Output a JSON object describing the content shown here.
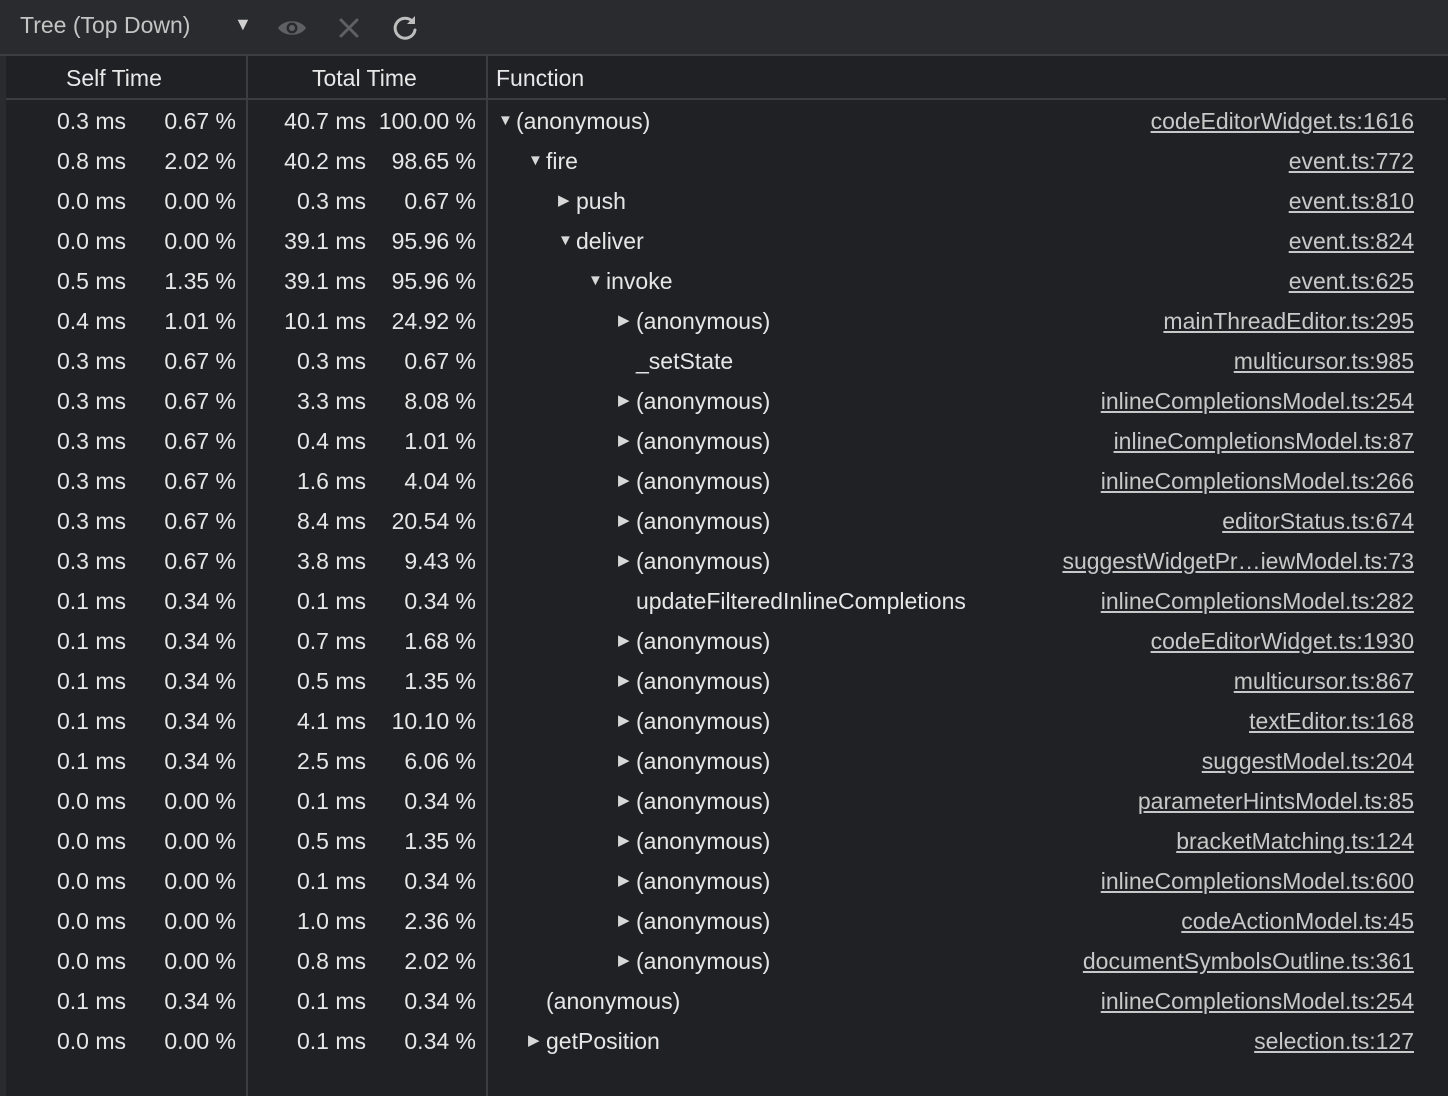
{
  "toolbar": {
    "view_select": "Tree (Top Down)",
    "icons": [
      "eye-icon",
      "close-icon",
      "reload-icon"
    ]
  },
  "headers": {
    "self_time": "Self Time",
    "total_time": "Total Time",
    "function": "Function"
  },
  "rows": [
    {
      "self": "0.3 ms",
      "self_pct": "0.67 %",
      "total": "40.7 ms",
      "total_pct": "100.00 %",
      "depth": 0,
      "state": "expanded",
      "fn": "(anonymous)",
      "url": "codeEditorWidget.ts:1616"
    },
    {
      "self": "0.8 ms",
      "self_pct": "2.02 %",
      "total": "40.2 ms",
      "total_pct": "98.65 %",
      "depth": 1,
      "state": "expanded",
      "fn": "fire",
      "url": "event.ts:772"
    },
    {
      "self": "0.0 ms",
      "self_pct": "0.00 %",
      "total": "0.3 ms",
      "total_pct": "0.67 %",
      "depth": 2,
      "state": "collapsed",
      "fn": "push",
      "url": "event.ts:810"
    },
    {
      "self": "0.0 ms",
      "self_pct": "0.00 %",
      "total": "39.1 ms",
      "total_pct": "95.96 %",
      "depth": 2,
      "state": "expanded",
      "fn": "deliver",
      "url": "event.ts:824"
    },
    {
      "self": "0.5 ms",
      "self_pct": "1.35 %",
      "total": "39.1 ms",
      "total_pct": "95.96 %",
      "depth": 3,
      "state": "expanded",
      "fn": "invoke",
      "url": "event.ts:625"
    },
    {
      "self": "0.4 ms",
      "self_pct": "1.01 %",
      "total": "10.1 ms",
      "total_pct": "24.92 %",
      "depth": 4,
      "state": "collapsed",
      "fn": "(anonymous)",
      "url": "mainThreadEditor.ts:295"
    },
    {
      "self": "0.3 ms",
      "self_pct": "0.67 %",
      "total": "0.3 ms",
      "total_pct": "0.67 %",
      "depth": 4,
      "state": "leaf",
      "fn": "_setState",
      "url": "multicursor.ts:985"
    },
    {
      "self": "0.3 ms",
      "self_pct": "0.67 %",
      "total": "3.3 ms",
      "total_pct": "8.08 %",
      "depth": 4,
      "state": "collapsed",
      "fn": "(anonymous)",
      "url": "inlineCompletionsModel.ts:254"
    },
    {
      "self": "0.3 ms",
      "self_pct": "0.67 %",
      "total": "0.4 ms",
      "total_pct": "1.01 %",
      "depth": 4,
      "state": "collapsed",
      "fn": "(anonymous)",
      "url": "inlineCompletionsModel.ts:87"
    },
    {
      "self": "0.3 ms",
      "self_pct": "0.67 %",
      "total": "1.6 ms",
      "total_pct": "4.04 %",
      "depth": 4,
      "state": "collapsed",
      "fn": "(anonymous)",
      "url": "inlineCompletionsModel.ts:266"
    },
    {
      "self": "0.3 ms",
      "self_pct": "0.67 %",
      "total": "8.4 ms",
      "total_pct": "20.54 %",
      "depth": 4,
      "state": "collapsed",
      "fn": "(anonymous)",
      "url": "editorStatus.ts:674"
    },
    {
      "self": "0.3 ms",
      "self_pct": "0.67 %",
      "total": "3.8 ms",
      "total_pct": "9.43 %",
      "depth": 4,
      "state": "collapsed",
      "fn": "(anonymous)",
      "url": "suggestWidgetPr…iewModel.ts:73"
    },
    {
      "self": "0.1 ms",
      "self_pct": "0.34 %",
      "total": "0.1 ms",
      "total_pct": "0.34 %",
      "depth": 4,
      "state": "leaf",
      "fn": "updateFilteredInlineCompletions",
      "url": "inlineCompletionsModel.ts:282"
    },
    {
      "self": "0.1 ms",
      "self_pct": "0.34 %",
      "total": "0.7 ms",
      "total_pct": "1.68 %",
      "depth": 4,
      "state": "collapsed",
      "fn": "(anonymous)",
      "url": "codeEditorWidget.ts:1930"
    },
    {
      "self": "0.1 ms",
      "self_pct": "0.34 %",
      "total": "0.5 ms",
      "total_pct": "1.35 %",
      "depth": 4,
      "state": "collapsed",
      "fn": "(anonymous)",
      "url": "multicursor.ts:867"
    },
    {
      "self": "0.1 ms",
      "self_pct": "0.34 %",
      "total": "4.1 ms",
      "total_pct": "10.10 %",
      "depth": 4,
      "state": "collapsed",
      "fn": "(anonymous)",
      "url": "textEditor.ts:168"
    },
    {
      "self": "0.1 ms",
      "self_pct": "0.34 %",
      "total": "2.5 ms",
      "total_pct": "6.06 %",
      "depth": 4,
      "state": "collapsed",
      "fn": "(anonymous)",
      "url": "suggestModel.ts:204"
    },
    {
      "self": "0.0 ms",
      "self_pct": "0.00 %",
      "total": "0.1 ms",
      "total_pct": "0.34 %",
      "depth": 4,
      "state": "collapsed",
      "fn": "(anonymous)",
      "url": "parameterHintsModel.ts:85"
    },
    {
      "self": "0.0 ms",
      "self_pct": "0.00 %",
      "total": "0.5 ms",
      "total_pct": "1.35 %",
      "depth": 4,
      "state": "collapsed",
      "fn": "(anonymous)",
      "url": "bracketMatching.ts:124"
    },
    {
      "self": "0.0 ms",
      "self_pct": "0.00 %",
      "total": "0.1 ms",
      "total_pct": "0.34 %",
      "depth": 4,
      "state": "collapsed",
      "fn": "(anonymous)",
      "url": "inlineCompletionsModel.ts:600"
    },
    {
      "self": "0.0 ms",
      "self_pct": "0.00 %",
      "total": "1.0 ms",
      "total_pct": "2.36 %",
      "depth": 4,
      "state": "collapsed",
      "fn": "(anonymous)",
      "url": "codeActionModel.ts:45"
    },
    {
      "self": "0.0 ms",
      "self_pct": "0.00 %",
      "total": "0.8 ms",
      "total_pct": "2.02 %",
      "depth": 4,
      "state": "collapsed",
      "fn": "(anonymous)",
      "url": "documentSymbolsOutline.ts:361"
    },
    {
      "self": "0.1 ms",
      "self_pct": "0.34 %",
      "total": "0.1 ms",
      "total_pct": "0.34 %",
      "depth": 1,
      "state": "leaf",
      "fn": "(anonymous)",
      "url": "inlineCompletionsModel.ts:254"
    },
    {
      "self": "0.0 ms",
      "self_pct": "0.00 %",
      "total": "0.1 ms",
      "total_pct": "0.34 %",
      "depth": 1,
      "state": "collapsed",
      "fn": "getPosition",
      "url": "selection.ts:127"
    }
  ]
}
